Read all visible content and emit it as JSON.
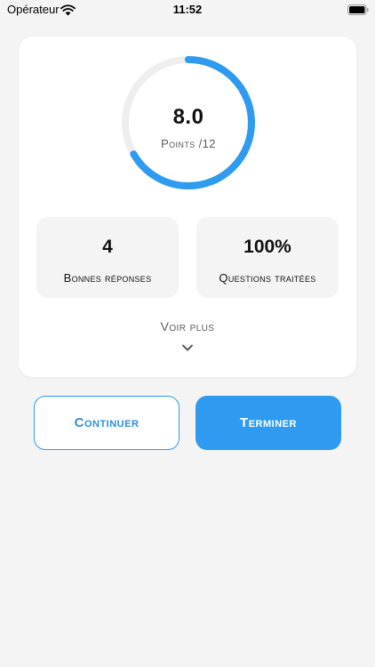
{
  "status_bar": {
    "carrier": "Opérateur",
    "time": "11:52",
    "icons": [
      "wifi-icon",
      "battery-icon"
    ]
  },
  "score": {
    "value": "8.0",
    "caption": "Points /12",
    "progress_fraction": 0.667,
    "ring_color": "#2f9bf0",
    "track_color": "#eeeeee"
  },
  "stats": [
    {
      "value": "4",
      "label": "Bonnes réponses"
    },
    {
      "value": "100%",
      "label": "Questions traitées"
    }
  ],
  "see_more": {
    "label": "Voir plus",
    "icon": "chevron-down-icon"
  },
  "buttons": {
    "continue_label": "Continuer",
    "finish_label": "Terminer"
  },
  "colors": {
    "accent": "#2f9bf0",
    "background": "#f4f4f4",
    "card": "#ffffff"
  }
}
